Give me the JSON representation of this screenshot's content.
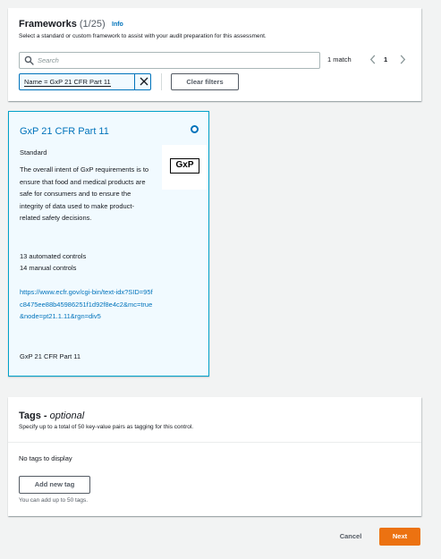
{
  "frameworks": {
    "title": "Frameworks",
    "count": "(1/25)",
    "info_label": "Info",
    "description": "Select a standard or custom framework to assist with your audit preparation for this assessment.",
    "search": {
      "placeholder": "Search",
      "value": ""
    },
    "match_count": "1 match",
    "page": "1",
    "filter_token": "Name = GxP 21 CFR Part 11",
    "clear_filters_label": "Clear filters"
  },
  "card": {
    "title": "GxP 21 CFR Part 11",
    "type": "Standard",
    "logo_text": "GxP",
    "description": "The overall intent of GxP requirements is to ensure that food and medical products are safe for consumers and to ensure the integrity of data used to make product-related safety decisions.",
    "automated_controls": "13 automated controls",
    "manual_controls": "14 manual controls",
    "url": "https://www.ecfr.gov/cgi-bin/text-idx?SID=95fc8475ee88b45986251f1d92f8e4c2&mc=true&node=pt21.1.11&rgn=div5",
    "footer": "GxP 21 CFR Part 11",
    "selected": true
  },
  "tags": {
    "title": "Tags -",
    "optional_label": "optional",
    "description": "Specify up to a total of 50 key-value pairs as tagging for this control.",
    "empty_text": "No tags to display",
    "add_button_label": "Add new tag",
    "hint": "You can add up to 50 tags."
  },
  "actions": {
    "cancel_label": "Cancel",
    "next_label": "Next"
  },
  "colors": {
    "accent": "#0073bb",
    "primary_button": "#ec7211",
    "selected_card_bg": "#f1faff",
    "page_bg": "#f2f3f3"
  },
  "icons": {
    "search": "search-icon",
    "pager_prev": "chevron-left-icon",
    "pager_next": "chevron-right-icon",
    "token_close": "close-icon",
    "radio": "radio-selected-icon"
  }
}
